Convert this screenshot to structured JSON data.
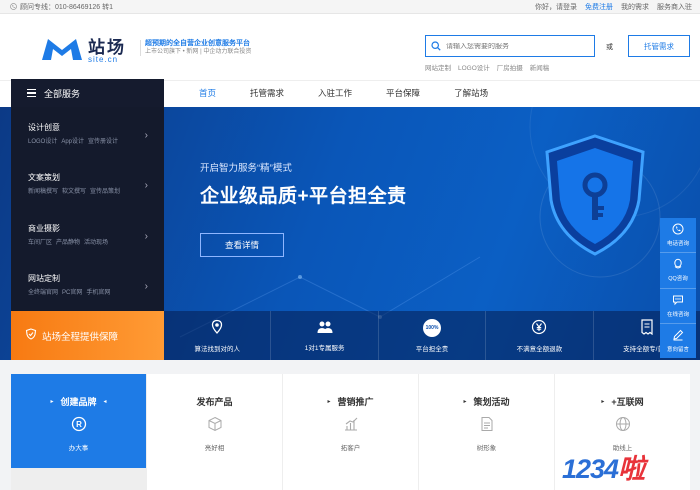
{
  "topbar": {
    "phone": "顾问专线：010-86469126 转1",
    "greeting": "你好，请登录",
    "register": "免费注册",
    "my_requests": "我的需求",
    "provider_join": "服务商入驻"
  },
  "brand": {
    "name_cn": "站场",
    "name_en": "site.cn",
    "slogan_main": "超预期的全自营企业创意服务平台",
    "slogan_sub": "上市公司旗下 • 新网 | 中企动力联合投资"
  },
  "search": {
    "placeholder": "请输入您需要的服务",
    "hotwords": [
      "网站定制",
      "LOGO设计",
      "厂房拍摄",
      "新闻稿"
    ]
  },
  "header": {
    "or": "或",
    "post_button": "托管需求"
  },
  "nav": {
    "all_services": "全部服务",
    "items": [
      "首页",
      "托管需求",
      "入驻工作",
      "平台保障",
      "了解站场"
    ]
  },
  "categories": [
    {
      "title": "设计创意",
      "subs": [
        "LOGO设计",
        "App设计",
        "宣传册设计"
      ]
    },
    {
      "title": "文案策划",
      "subs": [
        "新闻稿撰写",
        "软文撰写",
        "宣传品策划"
      ]
    },
    {
      "title": "商业摄影",
      "subs": [
        "车间厂区",
        "产品静物",
        "活动现场"
      ]
    },
    {
      "title": "网站定制",
      "subs": [
        "全终端官网",
        "PC官网",
        "手机官网"
      ]
    }
  ],
  "guarantee": "站场全程提供保障",
  "hero": {
    "subtitle": "开启智力服务“精”模式",
    "title": "企业级品质+平台担全责",
    "button": "查看详情"
  },
  "features": [
    {
      "label": "算法找到对的人",
      "icon": "location-icon"
    },
    {
      "label": "1对1专属服务",
      "icon": "team-icon"
    },
    {
      "label": "平台担全责",
      "icon": "percent-badge-icon",
      "badge": "100%"
    },
    {
      "label": "不满意全额退款",
      "icon": "yen-icon"
    },
    {
      "label": "支持全额专/普票",
      "icon": "invoice-icon"
    }
  ],
  "right_tools": [
    "电话咨询",
    "QQ咨询",
    "在线咨询",
    "意向留言"
  ],
  "cards": [
    {
      "title": "创建品牌",
      "desc": "办大事",
      "icon": "registered-icon"
    },
    {
      "title": "发布产品",
      "desc": "亮好相",
      "icon": "box-icon"
    },
    {
      "title": "营销推广",
      "desc": "拓客户",
      "icon": "chart-icon"
    },
    {
      "title": "策划活动",
      "desc": "树形象",
      "icon": "document-icon"
    },
    {
      "title": "+互联网",
      "desc": "助线上",
      "icon": "globe-icon"
    }
  ],
  "watermark": {
    "digits": "1234",
    "suffix": "啦"
  },
  "colors": {
    "accent": "#1e7be6",
    "dark": "#141a2c",
    "orange": "#f7841c"
  }
}
